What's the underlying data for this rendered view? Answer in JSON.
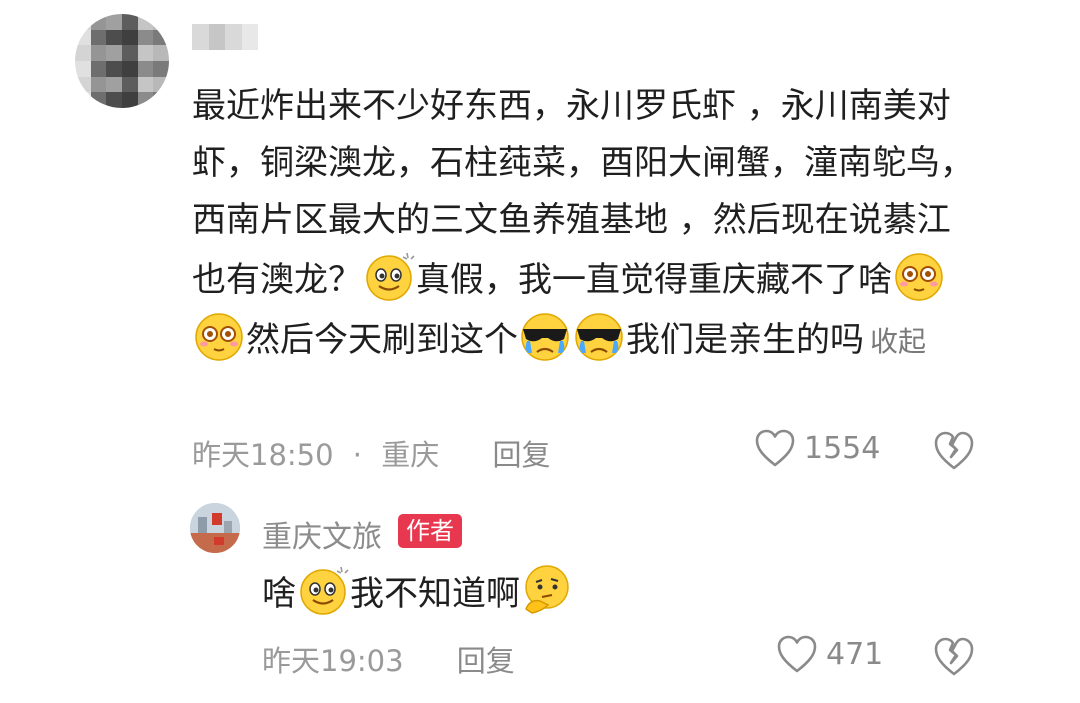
{
  "comment": {
    "segments": [
      {
        "text": "最近炸出来不少好东西，永川罗氏虾 ，永川南美对虾，铜梁澳龙，石柱莼菜，酉阳大闸蟹，潼南鸵鸟，西南片区最大的三文鱼养殖基地 ，然后现在说綦江也有澳龙？"
      },
      {
        "emoji": "grin-sparkle-emoji"
      },
      {
        "text": "真假，我一直觉得重庆藏不了啥"
      },
      {
        "emoji": "dizzy-eyes-emoji"
      },
      {
        "emoji": "dizzy-eyes-emoji"
      },
      {
        "text": "然后今天刷到这个"
      },
      {
        "emoji": "sunglasses-crying-emoji"
      },
      {
        "emoji": "sunglasses-crying-emoji"
      },
      {
        "text": "我们是亲生的吗"
      }
    ],
    "collapse_label": "收起",
    "time": "昨天18:50",
    "separator": "·",
    "location": "重庆",
    "reply_label": "回复",
    "like_count": "1554"
  },
  "reply": {
    "author": "重庆文旅",
    "badge": "作者",
    "segments": [
      {
        "text": "啥"
      },
      {
        "emoji": "grin-sparkle-emoji"
      },
      {
        "text": "我不知道啊"
      },
      {
        "emoji": "thinking-emoji"
      }
    ],
    "time": "昨天19:03",
    "reply_label": "回复",
    "like_count": "471"
  },
  "colors": {
    "accent_badge": "#e8384f",
    "meta_gray": "#9a9a9a",
    "text": "#1f1f1f"
  }
}
